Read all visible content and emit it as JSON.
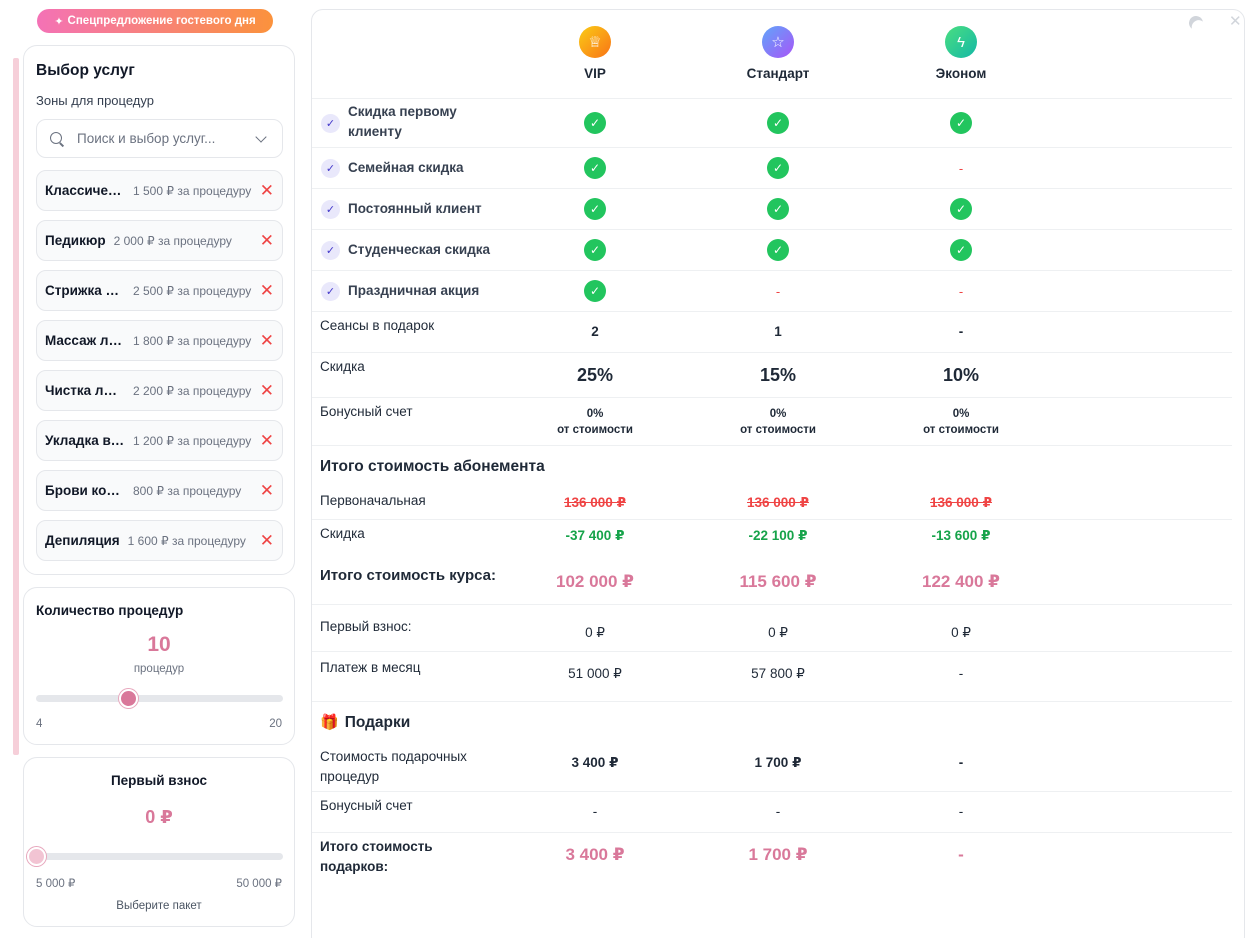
{
  "promo": {
    "label": "Спецпредложение гостевого дня",
    "icon": "sparkles-icon"
  },
  "services": {
    "title": "Выбор услуг",
    "subtitle": "Зоны для процедур",
    "search_placeholder": "Поиск и выбор услуг...",
    "items": [
      {
        "name": "Классический маникюр",
        "price": "1 500 ₽ за процедуру"
      },
      {
        "name": "Педикюр",
        "price": "2 000 ₽ за процедуру"
      },
      {
        "name": "Стрижка волос",
        "price": "2 500 ₽ за процедуру"
      },
      {
        "name": "Массаж лица",
        "price": "1 800 ₽ за процедуру"
      },
      {
        "name": "Чистка лица",
        "price": "2 200 ₽ за процедуру"
      },
      {
        "name": "Укладка волос",
        "price": "1 200 ₽ за процедуру"
      },
      {
        "name": "Брови коррекция",
        "price": "800 ₽ за процедуру"
      },
      {
        "name": "Депиляция",
        "price": "1 600 ₽ за процедуру"
      }
    ],
    "remove_icon": "✕"
  },
  "count": {
    "title": "Количество процедур",
    "value": "10",
    "unit": "процедур",
    "min": "4",
    "max": "20",
    "current": 10,
    "range_min": 4,
    "range_max": 20
  },
  "fee": {
    "title": "Первый взнос",
    "value": "0 ₽",
    "min": "5 000 ₽",
    "max": "50 000 ₽",
    "note": "Выберите пакет",
    "level": 0
  },
  "header": {
    "close": "✕"
  },
  "plans": [
    {
      "name": "VIP",
      "icon": "crown-icon",
      "glyph": "♕",
      "color_from": "#facc15",
      "color_to": "#f97316"
    },
    {
      "name": "Стандарт",
      "icon": "star-icon",
      "glyph": "☆",
      "color_from": "#60a5fa",
      "color_to": "#a855f7"
    },
    {
      "name": "Эконом",
      "icon": "lightning-icon",
      "glyph": "ϟ",
      "color_from": "#4ade80",
      "color_to": "#14b8a6"
    }
  ],
  "features": [
    {
      "label": "Скидка первому клиенту",
      "values": [
        true,
        true,
        true
      ]
    },
    {
      "label": "Семейная скидка",
      "values": [
        true,
        true,
        false
      ]
    },
    {
      "label": "Постоянный клиент",
      "values": [
        true,
        true,
        true
      ]
    },
    {
      "label": "Студенческая скидка",
      "values": [
        true,
        true,
        true
      ]
    },
    {
      "label": "Праздничная акция",
      "values": [
        true,
        false,
        false
      ]
    }
  ],
  "check_glyph": "✓",
  "feature_badge_glyph": "✓",
  "dash": "-",
  "sessions": {
    "label": "Сеансы в подарок",
    "values": [
      "2",
      "1",
      "-"
    ]
  },
  "discount": {
    "label": "Скидка",
    "values": [
      "25%",
      "15%",
      "10%"
    ]
  },
  "bonus": {
    "label": "Бонусный счет",
    "values": [
      "0%",
      "0%",
      "0%"
    ],
    "sub": "от стоимости"
  },
  "total": {
    "title": "Итого стоимость абонемента",
    "initial": {
      "label": "Первоначальная",
      "values": [
        "136 000 ₽",
        "136 000 ₽",
        "136 000 ₽"
      ]
    },
    "discount": {
      "label": "Скидка",
      "values": [
        "-37 400 ₽",
        "-22 100 ₽",
        "-13 600 ₽"
      ]
    },
    "course": {
      "label": "Итого стоимость курса:",
      "values": [
        "102 000 ₽",
        "115 600 ₽",
        "122 400 ₽"
      ]
    },
    "first": {
      "label": "Первый взнос:",
      "values": [
        "0 ₽",
        "0 ₽",
        "0 ₽"
      ]
    },
    "monthly": {
      "label": "Платеж в месяц",
      "values": [
        "51 000 ₽",
        "57 800 ₽",
        "-"
      ]
    }
  },
  "gifts": {
    "title": "Подарки",
    "icon": "gift-icon",
    "glyph": "🎁",
    "cost": {
      "label": "Стоимость подарочных процедур",
      "values": [
        "3 400 ₽",
        "1 700 ₽",
        "-"
      ]
    },
    "bonus": {
      "label": "Бонусный счет",
      "values": [
        "-",
        "-",
        "-"
      ]
    },
    "total": {
      "label": "Итого стоимость подарков:",
      "values": [
        "3 400 ₽",
        "1 700 ₽",
        "-"
      ]
    }
  }
}
